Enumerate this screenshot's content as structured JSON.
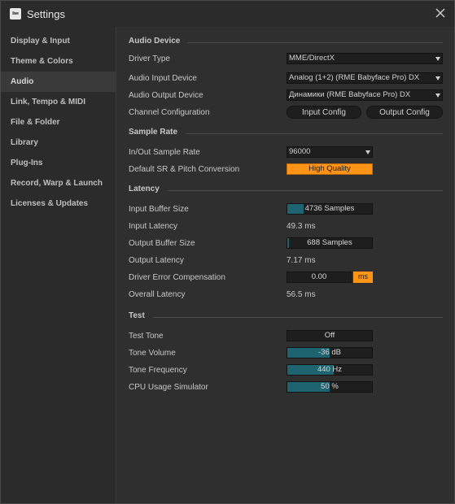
{
  "window": {
    "app_logo": "live",
    "title": "Settings",
    "close_icon": "close-icon"
  },
  "sidebar": {
    "items": [
      {
        "label": "Display & Input"
      },
      {
        "label": "Theme & Colors"
      },
      {
        "label": "Audio",
        "active": true
      },
      {
        "label": "Link, Tempo & MIDI"
      },
      {
        "label": "File & Folder"
      },
      {
        "label": "Library"
      },
      {
        "label": "Plug-Ins"
      },
      {
        "label": "Record, Warp & Launch"
      },
      {
        "label": "Licenses & Updates"
      }
    ]
  },
  "audio_device": {
    "heading": "Audio Device",
    "driver_type": {
      "label": "Driver Type",
      "value": "MME/DirectX"
    },
    "input_device": {
      "label": "Audio Input Device",
      "value": "Analog (1+2) (RME Babyface Pro) DX"
    },
    "output_device": {
      "label": "Audio Output Device",
      "value": "Динамики (RME Babyface Pro) DX"
    },
    "channel_config": {
      "label": "Channel Configuration",
      "input_button": "Input Config",
      "output_button": "Output Config"
    }
  },
  "sample_rate": {
    "heading": "Sample Rate",
    "in_out": {
      "label": "In/Out Sample Rate",
      "value": "96000"
    },
    "default_sr": {
      "label": "Default SR & Pitch Conversion",
      "value": "High Quality"
    }
  },
  "latency": {
    "heading": "Latency",
    "input_buffer": {
      "label": "Input Buffer Size",
      "value": "4736 Samples",
      "fill": 0.19
    },
    "input_latency": {
      "label": "Input Latency",
      "value": "49.3 ms"
    },
    "output_buffer": {
      "label": "Output Buffer Size",
      "value": "688 Samples",
      "fill": 0.02
    },
    "output_latency": {
      "label": "Output Latency",
      "value": "7.17 ms"
    },
    "error_comp": {
      "label": "Driver Error Compensation",
      "value": "0.00",
      "unit": "ms"
    },
    "overall": {
      "label": "Overall Latency",
      "value": "56.5 ms"
    }
  },
  "test": {
    "heading": "Test",
    "tone": {
      "label": "Test Tone",
      "value": "Off"
    },
    "volume": {
      "label": "Tone Volume",
      "value": "-36 dB",
      "fill": 0.5
    },
    "frequency": {
      "label": "Tone Frequency",
      "value": "440 Hz",
      "fill": 0.55
    },
    "cpu": {
      "label": "CPU Usage Simulator",
      "value": "50 %",
      "fill": 0.5
    }
  },
  "colors": {
    "accent_orange": "#ff9417",
    "meter_teal": "#1e6470",
    "panel_bg": "#2f2f2f",
    "sidebar_bg": "#2b2b2b"
  }
}
